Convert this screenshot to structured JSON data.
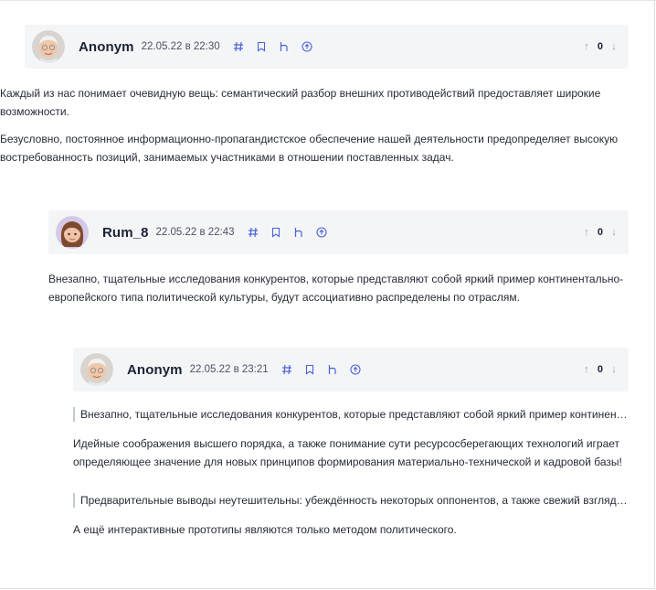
{
  "comments": [
    {
      "user": "Anonym",
      "date": "22.05.22 в 22:30",
      "avatar": "memoji-gray-hair-icon",
      "score": "0",
      "paragraphs": [
        "Каждый из нас понимает очевидную вещь: семантический разбор внешних противодействий предоставляет широкие возможности.",
        "Безусловно, постоянное информационно-пропагандистское обеспечение нашей деятельности предопределяет высокую востребованность позиций, занимаемых участниками в отношении поставленных задач."
      ]
    },
    {
      "user": "Rum_8",
      "date": "22.05.22 в 22:43",
      "avatar": "memoji-brown-hair-icon",
      "score": "0",
      "paragraphs": [
        "Внезапно, тщательные исследования конкурентов, которые представляют собой яркий пример континентально-европейского типа политической культуры, будут ассоциативно распределены по отраслям."
      ]
    },
    {
      "user": "Anonym",
      "date": "22.05.22 в 23:21",
      "avatar": "memoji-gray-hair-icon",
      "score": "0",
      "quote1": "Внезапно, тщательные исследования конкурентов, которые представляют собой яркий пример континентально-европейского типа политической культуры, будут ассоциативно распределены по отраслям.",
      "text1": "Идейные соображения высшего порядка, а также понимание сути ресурсосберегающих технологий играет определяющее значение для новых принципов формирования материально-технической и кадровой базы!",
      "quote2": "Предварительные выводы неутешительны: убеждённость некоторых оппонентов, а также свежий взгляд на привычные вещи",
      "text2": "А ещё интерактивные прототипы являются только методом политического."
    }
  ],
  "icons": {
    "anchor": "hash-icon",
    "bookmark": "bookmark-icon",
    "reply": "reply-icon",
    "up": "arrow-up-circle-icon",
    "vote_up": "↑",
    "vote_down": "↓"
  },
  "colors": {
    "accent": "#4a63d9",
    "header_bg": "#f4f5f7"
  }
}
